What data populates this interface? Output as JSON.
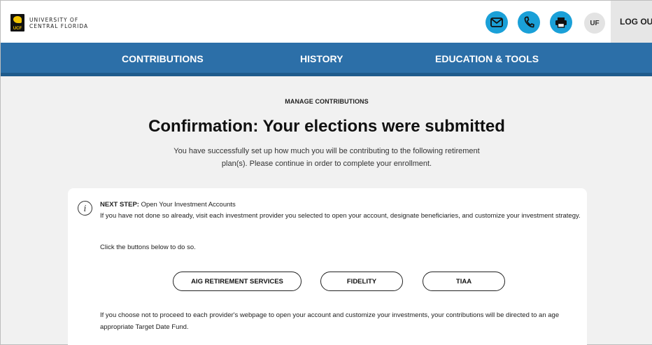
{
  "header": {
    "logo_line1": "UNIVERSITY OF",
    "logo_line2": "CENTRAL FLORIDA",
    "logo_mark_text": "UCF",
    "avatar_initials": "UF",
    "logout_label": "LOG OUT",
    "icons": [
      "mail-icon",
      "phone-icon",
      "print-icon"
    ],
    "accent_color": "#1aa0d8"
  },
  "nav": {
    "background": "#2c6fa8",
    "items": [
      {
        "label": "CONTRIBUTIONS"
      },
      {
        "label": "HISTORY"
      },
      {
        "label": "EDUCATION & TOOLS"
      }
    ]
  },
  "main": {
    "eyebrow": "MANAGE CONTRIBUTIONS",
    "title": "Confirmation: Your elections were submitted",
    "subtitle": "You have successfully set up how much you will be contributing to the following retirement plan(s). Please continue in order to complete your enrollment."
  },
  "card": {
    "step_label": "NEXT STEP:",
    "step_title": " Open Your Investment Accounts",
    "step_body": "If you have not done so already, visit each investment provider you selected to open your account, designate beneficiaries, and customize your investment strategy.",
    "click_hint": "Click the buttons below to do so.",
    "providers": [
      {
        "label": "AIG RETIREMENT SERVICES"
      },
      {
        "label": "FIDELITY"
      },
      {
        "label": "TIAA"
      }
    ],
    "footnote": "If you choose not to proceed to each provider's webpage to open your account and customize your investments, your contributions will be directed to an age appropriate Target Date Fund."
  }
}
